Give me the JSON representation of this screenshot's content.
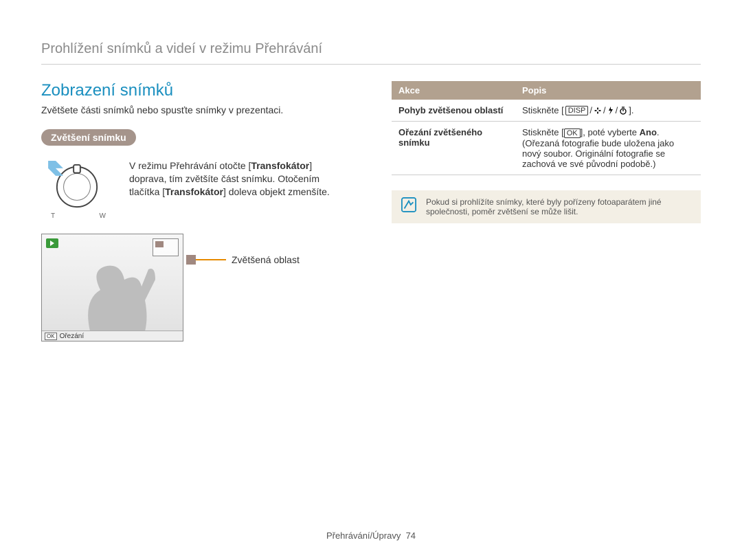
{
  "header": "Prohlížení snímků a videí v režimu Přehrávání",
  "section_title": "Zobrazení snímků",
  "intro": "Zvětšete části snímků nebo spusťte snímky v prezentaci.",
  "pill": "Zvětšení snímku",
  "dial_text_parts": {
    "p1": "V režimu Přehrávání otočte [",
    "p2": "Transfokátor",
    "p3": "] doprava, tím zvětšíte část snímku. Otočením tlačítka [",
    "p4": "Transfokátor",
    "p5": "] doleva objekt zmenšíte."
  },
  "dial_labels": {
    "left": "T",
    "right": "W"
  },
  "camera": {
    "crop_label": "Ořezání",
    "ok": "OK"
  },
  "zoom_caption": "Zvětšená oblast",
  "table": {
    "h1": "Akce",
    "h2": "Popis",
    "row1_action": "Pohyb zvětšenou oblastí",
    "row1_desc_prefix": "Stiskněte [",
    "row1_desc_suffix": "].",
    "row2_action": "Ořezání zvětšeného snímku",
    "row2_desc_p1": "Stiskněte [",
    "row2_desc_p2": "], poté vyberte ",
    "row2_desc_bold": "Ano",
    "row2_desc_p3": ". (Ořezaná fotografie bude uložena jako nový soubor. Originální fotografie se zachová ve své původní podobě.)",
    "ok_key": "OK",
    "disp_key": "DISP"
  },
  "note": "Pokud si prohlížíte snímky, které byly pořízeny fotoaparátem jiné společnosti, poměr zvětšení se může lišit.",
  "footer": {
    "label": "Přehrávání/Úpravy",
    "page": "74"
  }
}
